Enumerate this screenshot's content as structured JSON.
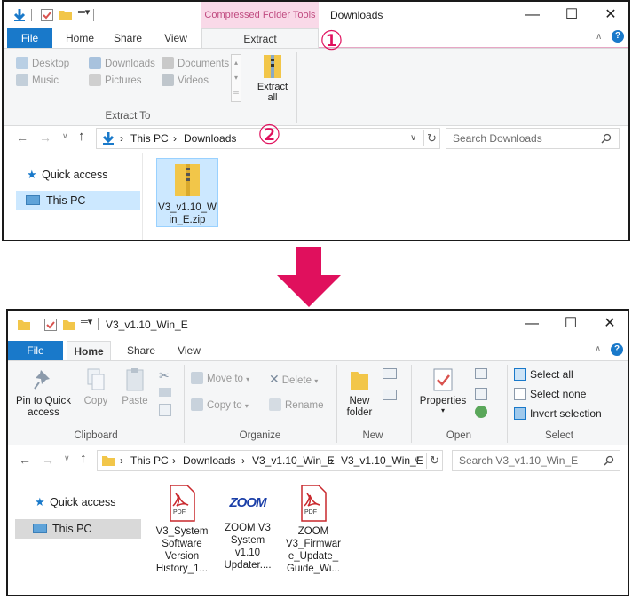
{
  "annotations": {
    "marker1": "①",
    "marker2": "②"
  },
  "window1": {
    "title": "Downloads",
    "context_tab_group": "Compressed Folder Tools",
    "tabs": [
      "File",
      "Home",
      "Share",
      "View",
      "Extract"
    ],
    "extract_to": {
      "items": [
        "Desktop",
        "Downloads",
        "Documents",
        "Music",
        "Pictures",
        "Videos"
      ],
      "group_label": "Extract To"
    },
    "extract_all_line1": "Extract",
    "extract_all_line2": "all",
    "address": {
      "root": "This PC",
      "folder": "Downloads"
    },
    "search_placeholder": "Search Downloads",
    "nav": [
      "Quick access",
      "This PC"
    ],
    "file": {
      "line1": "V3_v1.10_W",
      "line2": "in_E.zip"
    }
  },
  "window2": {
    "title": "V3_v1.10_Win_E",
    "tabs": [
      "File",
      "Home",
      "Share",
      "View"
    ],
    "clipboard": {
      "pin_line1": "Pin to Quick",
      "pin_line2": "access",
      "copy": "Copy",
      "paste": "Paste",
      "label": "Clipboard"
    },
    "organize": {
      "move_to": "Move to",
      "copy_to": "Copy to",
      "delete": "Delete",
      "rename": "Rename",
      "label": "Organize"
    },
    "new": {
      "line1": "New",
      "line2": "folder",
      "label": "New"
    },
    "open": {
      "properties": "Properties",
      "label": "Open"
    },
    "select": {
      "all": "Select all",
      "none": "Select none",
      "invert": "Invert selection",
      "label": "Select"
    },
    "address": {
      "a": "This PC",
      "b": "Downloads",
      "c": "V3_v1.10_Win_E",
      "d": "V3_v1.10_Win_E"
    },
    "search_placeholder": "Search V3_v1.10_Win_E",
    "nav": [
      "Quick access",
      "This PC"
    ],
    "files": [
      {
        "icon_label": "PDF",
        "lines": [
          "V3_System",
          "Software",
          "Version",
          "History_1..."
        ]
      },
      {
        "icon_label": "ZOOM",
        "lines": [
          "ZOOM V3",
          "System",
          "v1.10",
          "Updater...."
        ]
      },
      {
        "icon_label": "PDF",
        "lines": [
          "ZOOM",
          "V3_Firmwar",
          "e_Update_",
          "Guide_Wi..."
        ]
      }
    ]
  },
  "colors": {
    "accent_blue": "#1979ca",
    "magenta": "#e0105d",
    "context_tab_bg": "#f9d9e8",
    "context_tab_text": "#c04b80",
    "folder_yellow": "#f2c649"
  }
}
